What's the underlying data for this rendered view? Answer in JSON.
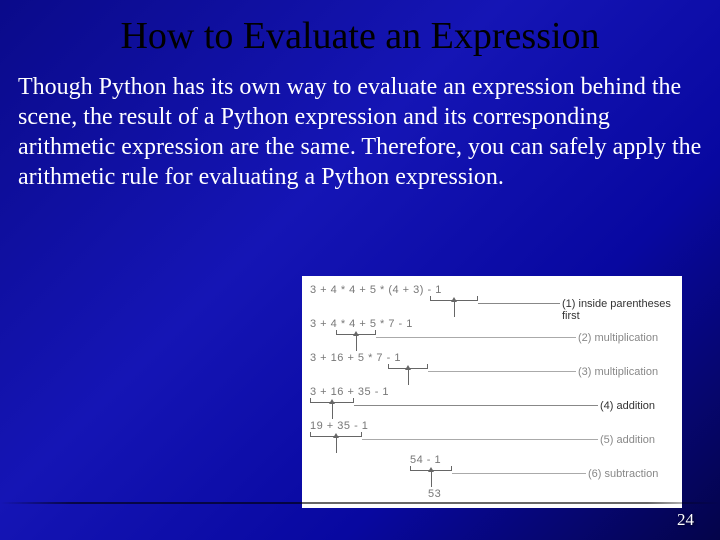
{
  "title": "How to Evaluate an Expression",
  "body": "Though Python has its own way to evaluate an expression behind the scene, the result of a Python expression and its corresponding arithmetic expression are the same. Therefore, you can safely apply the arithmetic rule for evaluating a Python expression.",
  "page_number": "24",
  "diagram": {
    "rows": [
      "3 + 4 * 4 + 5 * (4 + 3) - 1",
      "3 + 4 * 4 + 5 * 7 - 1",
      "3 + 16 + 5 * 7 - 1",
      "3 + 16 + 35 - 1",
      "19 + 35 - 1",
      "54 - 1",
      "53"
    ],
    "notes": [
      "(1) inside parentheses first",
      "(2) multiplication",
      "(3) multiplication",
      "(4) addition",
      "(5) addition",
      "(6) subtraction"
    ]
  }
}
